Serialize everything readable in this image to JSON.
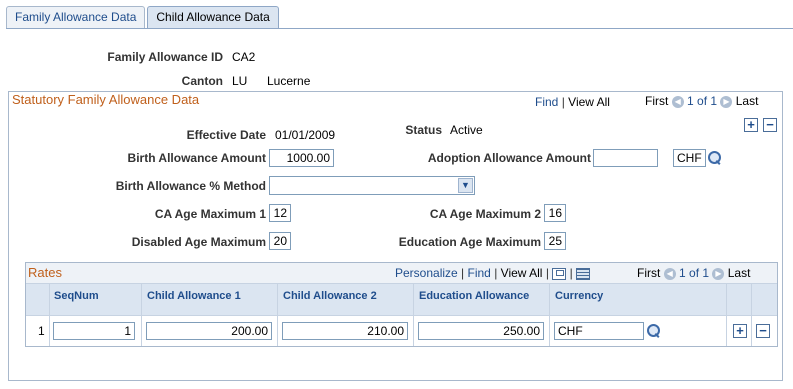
{
  "tabs": [
    {
      "label": "Family Allowance Data"
    },
    {
      "label": "Child Allowance Data"
    }
  ],
  "header": {
    "family_allowance_id_label": "Family Allowance ID",
    "family_allowance_id_value": "CA2",
    "canton_label": "Canton",
    "canton_code": "LU",
    "canton_name": "Lucerne"
  },
  "statutory": {
    "title": "Statutory Family Allowance Data",
    "find": "Find",
    "view_all": "View All",
    "first": "First",
    "count": "1 of 1",
    "last": "Last",
    "effective_date_label": "Effective Date",
    "effective_date_value": "01/01/2009",
    "status_label": "Status",
    "status_value": "Active",
    "birth_amount_label": "Birth Allowance Amount",
    "birth_amount_value": "1000.00",
    "adoption_amount_label": "Adoption Allowance Amount",
    "adoption_amount_value": "",
    "currency_value": "CHF",
    "birth_method_label": "Birth Allowance % Method",
    "birth_method_value": "",
    "ca_age_max1_label": "CA Age Maximum 1",
    "ca_age_max1_value": "12",
    "ca_age_max2_label": "CA Age Maximum 2",
    "ca_age_max2_value": "16",
    "disabled_age_max_label": "Disabled Age Maximum",
    "disabled_age_max_value": "20",
    "education_age_max_label": "Education Age Maximum",
    "education_age_max_value": "25"
  },
  "rates": {
    "title": "Rates",
    "personalize": "Personalize",
    "find": "Find",
    "view_all": "View All",
    "first": "First",
    "count": "1 of 1",
    "last": "Last",
    "columns": [
      "SeqNum",
      "Child Allowance 1",
      "Child Allowance 2",
      "Education Allowance",
      "Currency"
    ],
    "rows": [
      {
        "row_num": "1",
        "seqnum": "1",
        "child1": "200.00",
        "child2": "210.00",
        "education": "250.00",
        "currency": "CHF"
      }
    ]
  }
}
